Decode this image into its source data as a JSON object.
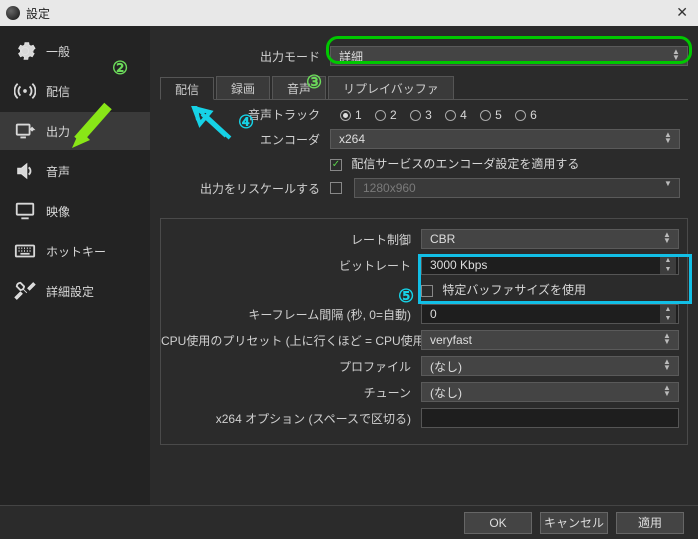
{
  "window": {
    "title": "設定"
  },
  "sidebar": {
    "items": [
      {
        "label": "一般"
      },
      {
        "label": "配信"
      },
      {
        "label": "出力"
      },
      {
        "label": "音声"
      },
      {
        "label": "映像"
      },
      {
        "label": "ホットキー"
      },
      {
        "label": "詳細設定"
      }
    ]
  },
  "mode": {
    "label": "出力モード",
    "value": "詳細"
  },
  "tabs": {
    "stream": "配信",
    "record": "録画",
    "audio": "音声",
    "replay": "リプレイバッファ"
  },
  "stream": {
    "audio_track_label": "音声トラック",
    "tracks": [
      "1",
      "2",
      "3",
      "4",
      "5",
      "6"
    ],
    "encoder_label": "エンコーダ",
    "encoder_value": "x264",
    "enforce_label": "配信サービスのエンコーダ設定を適用する",
    "rescale_label": "出力をリスケールする",
    "rescale_value": "1280x960"
  },
  "x264": {
    "rate_control_label": "レート制御",
    "rate_control_value": "CBR",
    "bitrate_label": "ビットレート",
    "bitrate_value": "3000 Kbps",
    "custom_buffer_label": "特定バッファサイズを使用",
    "keyframe_label": "キーフレーム間隔 (秒, 0=自動)",
    "keyframe_value": "0",
    "cpu_preset_label": "CPU使用のプリセット (上に行くほど = CPU使用低い)",
    "cpu_preset_value": "veryfast",
    "profile_label": "プロファイル",
    "profile_value": "(なし)",
    "tune_label": "チューン",
    "tune_value": "(なし)",
    "x264opts_label": "x264 オプション (スペースで区切る)"
  },
  "buttons": {
    "ok": "OK",
    "cancel": "キャンセル",
    "apply": "適用"
  },
  "annotations": {
    "n2": "②",
    "n3": "③",
    "n4": "④",
    "n5": "⑤"
  }
}
